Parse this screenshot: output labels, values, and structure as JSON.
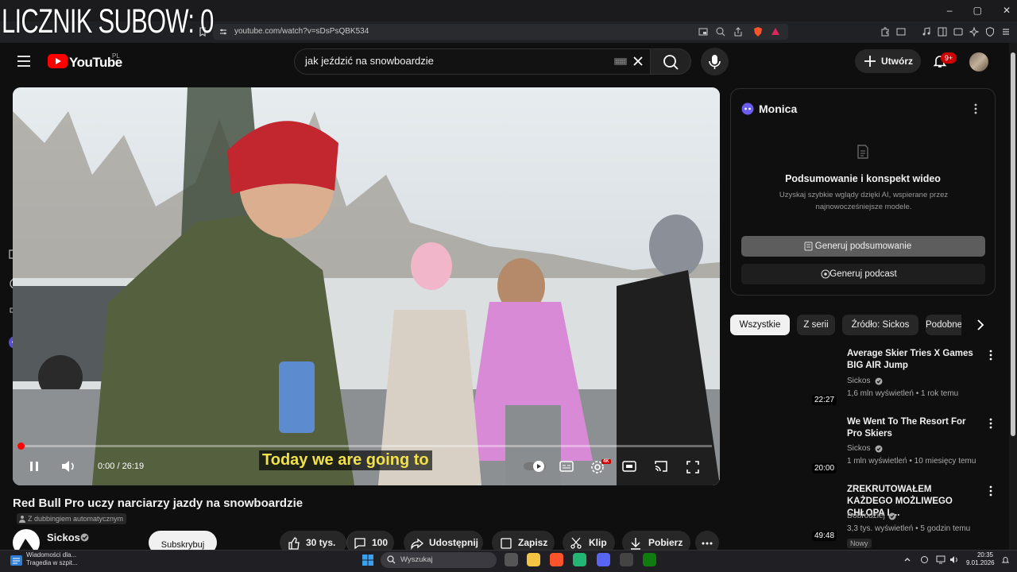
{
  "overlay": {
    "counter_text": "LICZNIK SUBOW: 0"
  },
  "browser": {
    "url": "youtube.com/watch?v=sDsPsQBK534",
    "window_controls": [
      "–",
      "▢",
      "✕"
    ]
  },
  "header": {
    "logo_text": "YouTube",
    "region": "PL",
    "search_query": "jak jeździć na snowboardzie",
    "create_label": "Utwórz",
    "notifications_badge": "9+"
  },
  "player": {
    "caption": "Today we are going to",
    "time": "0:00 / 26:19",
    "progress_fraction": 0.0,
    "hd_badge": "4K"
  },
  "video": {
    "title": "Red Bull Pro uczy narciarzy jazdy na snowboardzie",
    "dub_note": "Z dubbingiem automatycznym",
    "channel": "Sickos",
    "subscribe_label": "Subskrybuj",
    "likes": "30 tys.",
    "comments": "100",
    "share_label": "Udostępnij",
    "save_label": "Zapisz",
    "clip_label": "Klip",
    "download_label": "Pobierz"
  },
  "monica": {
    "title": "Monica",
    "heading": "Podsumowanie i konspekt wideo",
    "description": "Uzyskaj szybkie wglądy dzięki AI, wspierane przez najnowocześniejsze modele.",
    "summary_button": "Generuj podsumowanie",
    "podcast_button": "Generuj podcast"
  },
  "chips": [
    "Wszystkie",
    "Z serii",
    "Źródło: Sickos",
    "Podobne"
  ],
  "recommendations": [
    {
      "title": "Average Skier Tries X Games BIG AIR Jump",
      "channel": "Sickos",
      "meta": "1,6 mln wyświetleń • 1 rok temu",
      "duration": "22:27"
    },
    {
      "title": "We Went To The Resort For Pro Skiers",
      "channel": "Sickos",
      "meta": "1 mln wyświetleń • 10 miesięcy temu",
      "duration": "20:00"
    },
    {
      "title": "ZREKRUTOWAŁEM KAŻDEGO MOŻLIWEGO CHŁOPA I ...",
      "channel": "Dobrodziej",
      "meta": "3,3 tys. wyświetleń • 5 godzin temu",
      "duration": "49:48",
      "badge": "Nowy"
    }
  ],
  "taskbar": {
    "news_line1": "Wiadomości dla...",
    "news_line2": "Tragedia w szpit...",
    "search_label": "Wyszukaj",
    "time": "20:35",
    "date": "9.01.2026"
  },
  "colors": {
    "accent_red": "#ff0000",
    "caption_yellow": "#f2e24a",
    "background": "#0f0f0f"
  }
}
